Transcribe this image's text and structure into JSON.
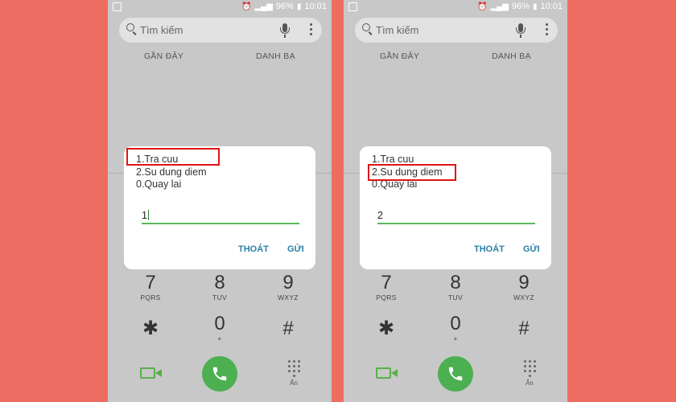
{
  "status_bar": {
    "battery": "96%",
    "time": "10:01"
  },
  "search": {
    "placeholder": "Tìm kiếm"
  },
  "tabs": {
    "recent": "GẦN ĐÂY",
    "contacts": "DANH BẠ"
  },
  "dialogs": [
    {
      "menu": [
        "1.Tra cuu",
        "2.Su dung diem",
        "0.Quay lai"
      ],
      "input_value": "1",
      "cancel_label": "THOÁT",
      "send_label": "GỬI",
      "highlighted_option": "1.Tra cuu"
    },
    {
      "menu": [
        "1.Tra cuu",
        "2.Su dung diem",
        "0.Quay lai"
      ],
      "input_value": "2",
      "cancel_label": "THOÁT",
      "send_label": "GỬI",
      "highlighted_option": "2.Su dung diem"
    }
  ],
  "keypad": {
    "row1": [
      {
        "digit": "7",
        "letters": "PQRS"
      },
      {
        "digit": "8",
        "letters": "TUV"
      },
      {
        "digit": "9",
        "letters": "WXYZ"
      }
    ],
    "row2": [
      {
        "digit": "✱",
        "letters": ""
      },
      {
        "digit": "0",
        "letters": "+"
      },
      {
        "digit": "#",
        "letters": ""
      }
    ]
  },
  "bottom": {
    "keypad_label": "Ẩn"
  },
  "colors": {
    "background": "#ee6d63",
    "highlight": "#e01414",
    "call_button": "#4caf50",
    "dialog_action": "#2a7fa8",
    "input_underline": "#5cb85c"
  },
  "icons": [
    "search-icon",
    "mic-icon",
    "more-options-icon",
    "video-call-icon",
    "phone-icon",
    "keypad-icon"
  ]
}
